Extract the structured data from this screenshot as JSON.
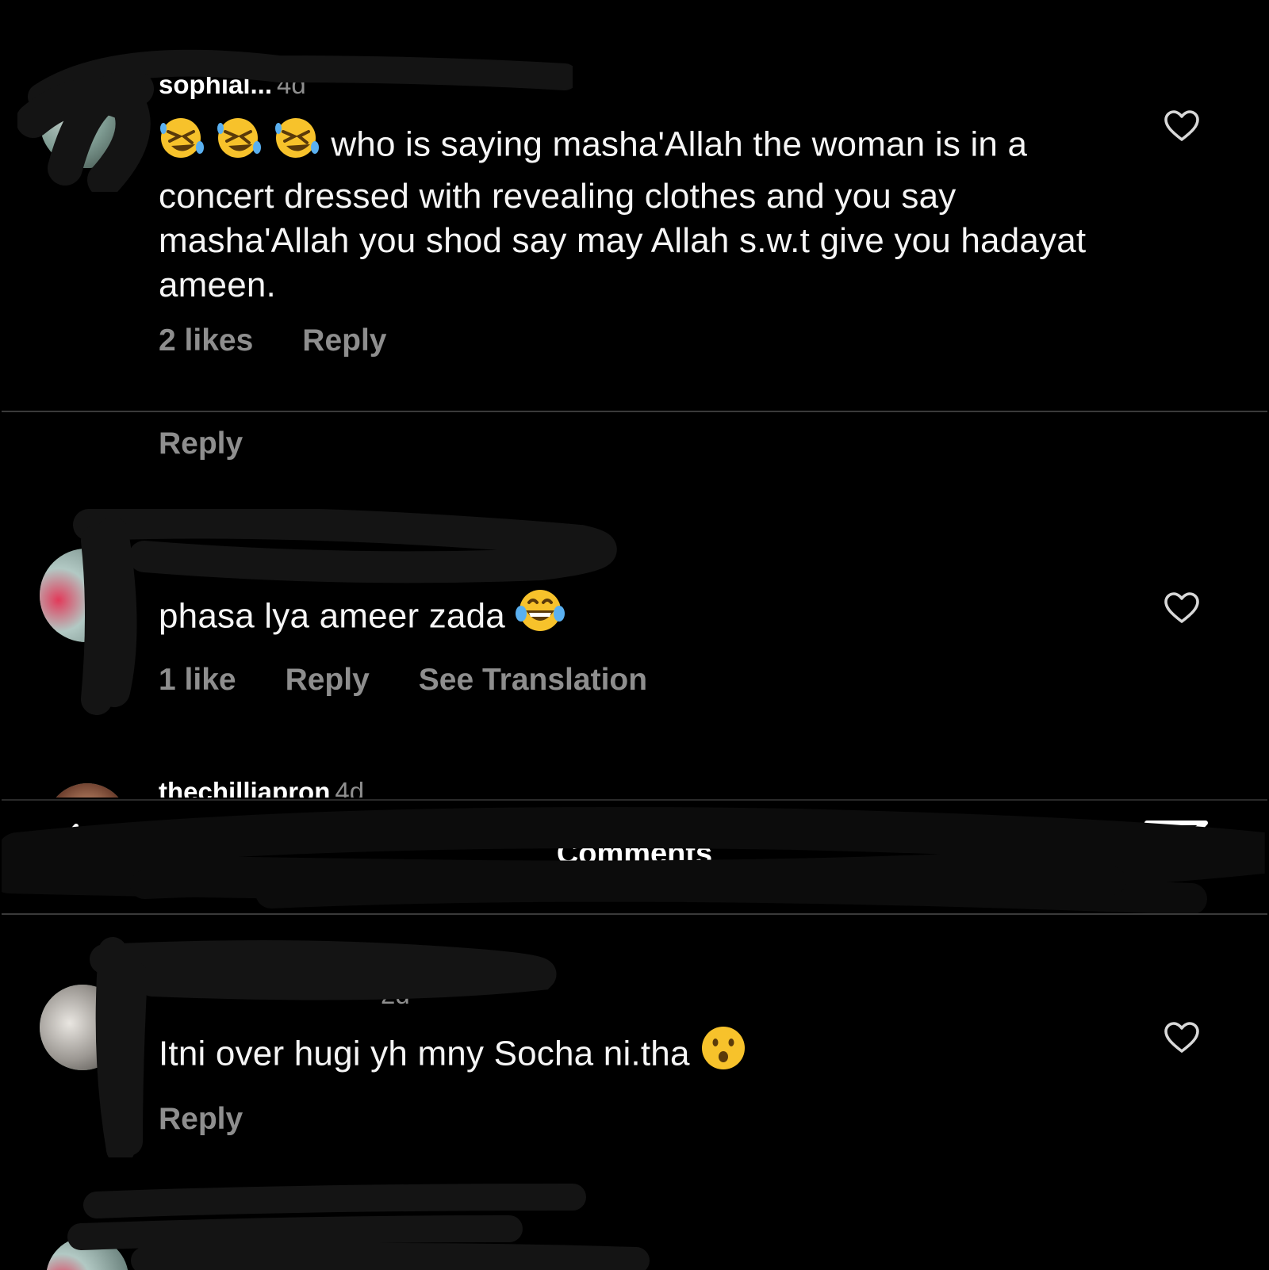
{
  "comments": [
    {
      "username": "sophial...",
      "time": "4d",
      "text": "who is saying masha'Allah the woman is in a concert dressed with revealing clothes and you say masha'Allah you shod say may Allah s.w.t give you hadayat ameen.",
      "leading_emoji": [
        "rolling-on-floor-laughing",
        "rolling-on-floor-laughing",
        "rolling-on-floor-laughing"
      ],
      "likes": "2 likes",
      "reply": "Reply",
      "like_icon": "heart-outline-icon"
    },
    {
      "reply": "Reply"
    },
    {
      "username": "",
      "time": "",
      "text": "phasa lya ameer zada",
      "trailing_emoji": "face-with-tears-of-joy",
      "likes": "1 like",
      "reply": "Reply",
      "translation": "See Translation",
      "like_icon": "heart-outline-icon"
    },
    {
      "username": "thechilliapron",
      "time": "4d"
    },
    {
      "username": "",
      "time": "2d",
      "text": "Itni over hugi yh mny Socha ni.tha",
      "trailing_emoji": "face-with-open-mouth",
      "reply": "Reply",
      "like_icon": "heart-outline-icon"
    }
  ],
  "header": {
    "title": "Comments",
    "back_icon": "back-arrow-icon",
    "share_icon": "send-icon"
  },
  "colors": {
    "background": "#000000",
    "text": "#ffffff",
    "secondary": "#8e8e8e",
    "divider": "#3a3a3a"
  }
}
